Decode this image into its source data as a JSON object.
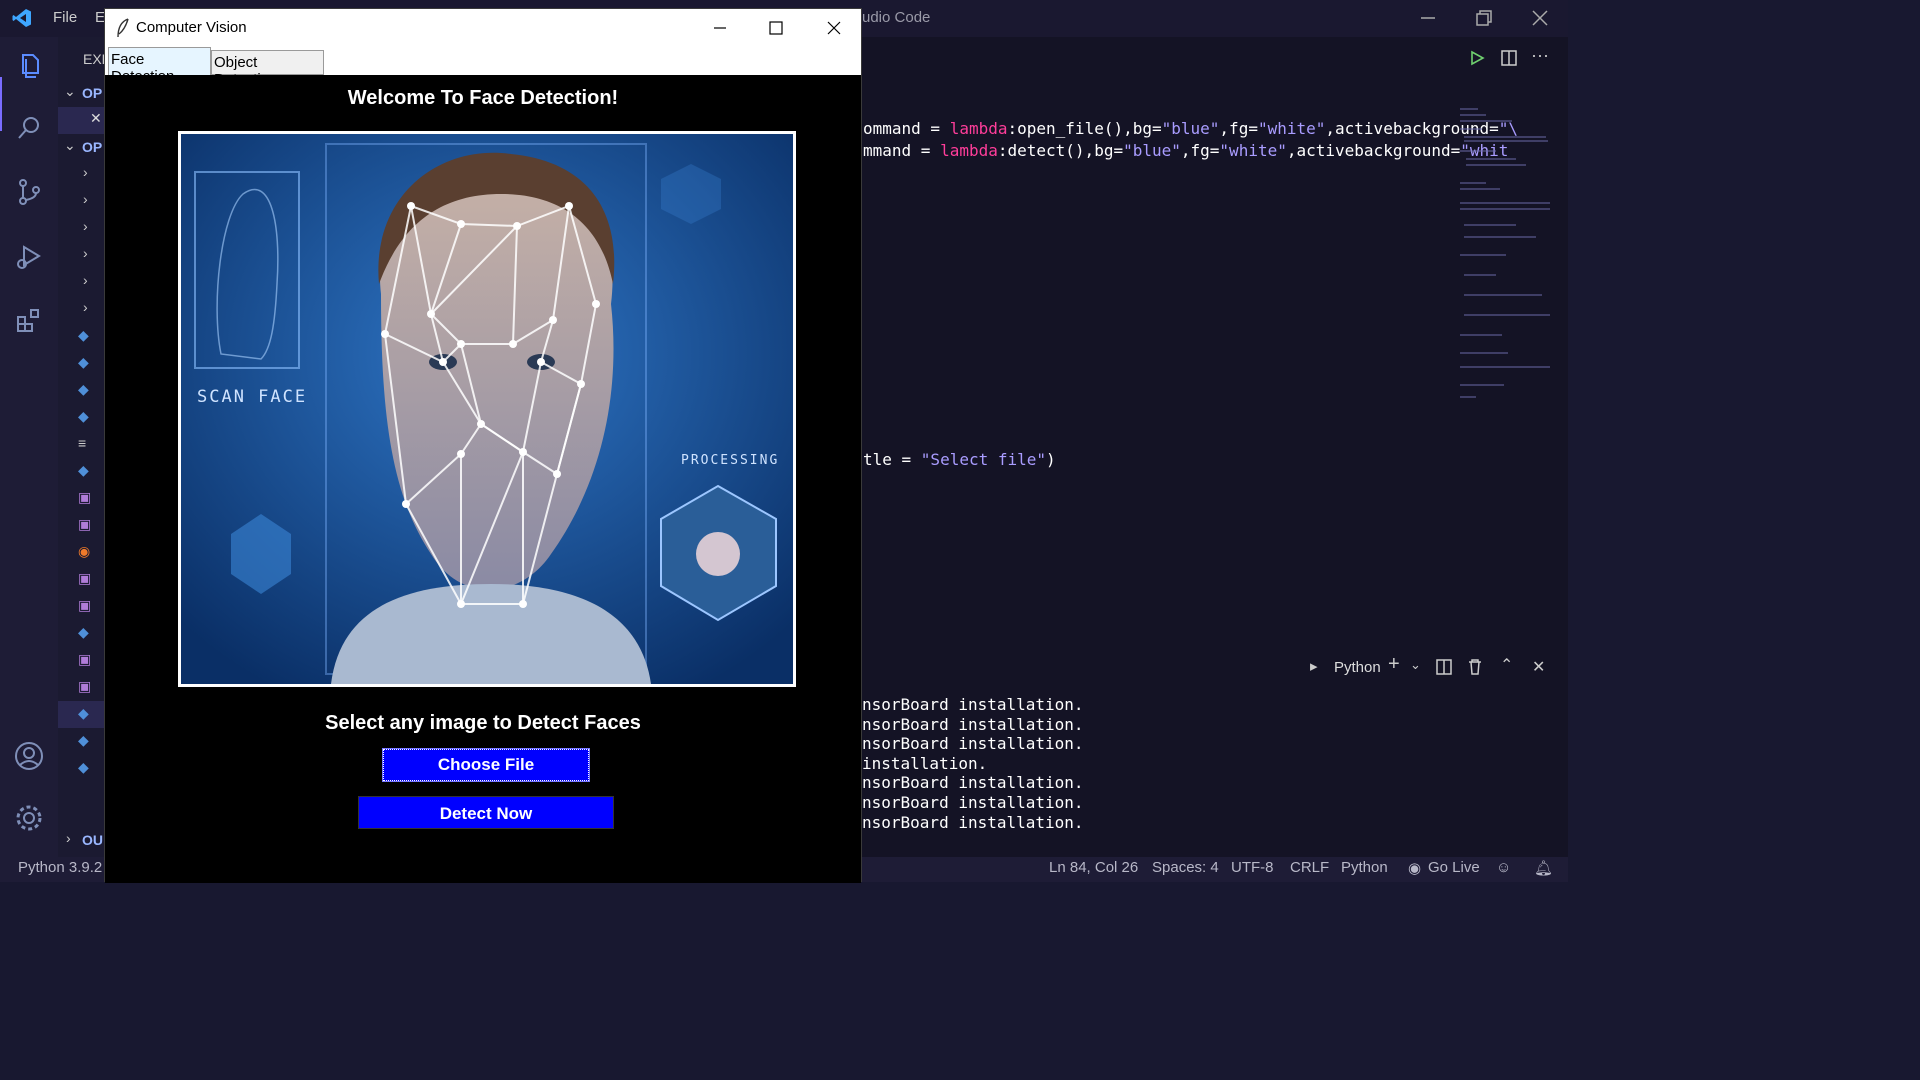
{
  "vscode": {
    "menu": [
      "File",
      "E"
    ],
    "title_fragment": "udio Code",
    "sidebar": {
      "header_fragment": "EXF",
      "sections": [
        "OP",
        "OP",
        "OU"
      ]
    },
    "code_lines": [
      {
        "pre": "ommand = ",
        "kw": "lambda",
        "mid": ":open_file(),bg=",
        "s1": "\"blue\"",
        "c1": ",fg=",
        "s2": "\"white\"",
        "c2": ",activebackground=",
        "s3": "\"\\"
      },
      {
        "pre": "mmand = ",
        "kw": "lambda",
        "mid": ":detect(),bg=",
        "s1": "\"blue\"",
        "c1": ",fg=",
        "s2": "\"white\"",
        "c2": ",activebackground=",
        "s3": "\"whit"
      },
      {
        "pre": "tle = ",
        "kw": "",
        "mid": "",
        "s1": "\"Select file\"",
        "c1": ")",
        "s2": "",
        "c2": "",
        "s3": ""
      }
    ],
    "panel": {
      "terminal_label": "Python",
      "terminal_lines": [
        "nsorBoard installation.",
        "nsorBoard installation.",
        "nsorBoard installation.",
        "installation.",
        "nsorBoard installation.",
        "nsorBoard installation.",
        "nsorBoard installation."
      ]
    },
    "statusbar": {
      "python_version": "Python 3.9.2",
      "position": "Ln 84, Col 26",
      "spaces": "Spaces: 4",
      "encoding": "UTF-8",
      "eol": "CRLF",
      "language": "Python",
      "golive": "Go Live"
    }
  },
  "tk": {
    "window_title": "Computer Vision",
    "tabs": [
      "Face Detection",
      "Object Detection"
    ],
    "welcome": "Welcome To Face Detection!",
    "image": {
      "left_label": "SCAN FACE",
      "right_label": "PROCESSING"
    },
    "select_text": "Select any image to Detect Faces",
    "choose_button": "Choose File",
    "detect_button": "Detect Now"
  },
  "colors": {
    "button_blue": "#0000ff",
    "accent": "#7a6cff",
    "keyword": "#ff3d9a",
    "string": "#a99cff"
  }
}
